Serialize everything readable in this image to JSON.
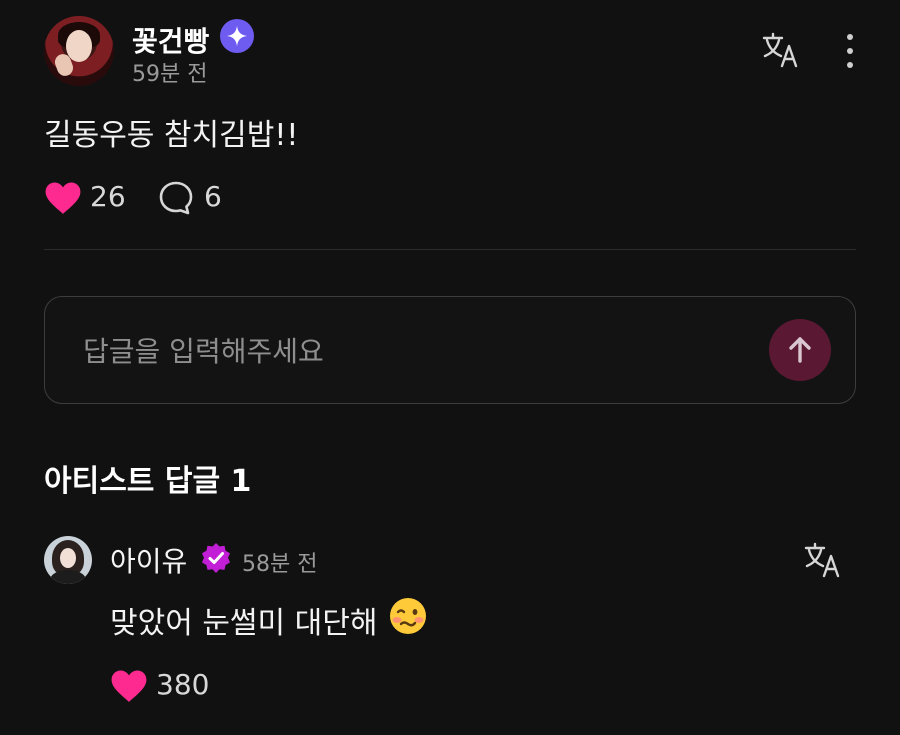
{
  "post": {
    "author": "꽃건빵",
    "time": "59분 전",
    "body": "길동우동 참치김밥!!",
    "likes": "26",
    "comments": "6"
  },
  "reply": {
    "placeholder": "답글을 입력해주세요"
  },
  "artist_replies": {
    "title": "아티스트 답글 1",
    "items": [
      {
        "author": "아이유",
        "time": "58분 전",
        "text": "맞았어 눈썰미 대단해",
        "likes": "380"
      }
    ]
  },
  "colors": {
    "background": "#121112",
    "heart": "#ff2a8f",
    "star_badge": "#6e5cf0",
    "verified_badge": "#c21ed6",
    "send_button": "#5a1833"
  },
  "icons": {
    "star_badge": "star-badge-icon",
    "translate": "translate-icon",
    "more": "more-vertical-icon",
    "heart": "heart-icon",
    "comment": "comment-bubble-icon",
    "send": "arrow-up-icon",
    "verified": "verified-badge-icon",
    "emoji": "woozy-face-emoji"
  }
}
